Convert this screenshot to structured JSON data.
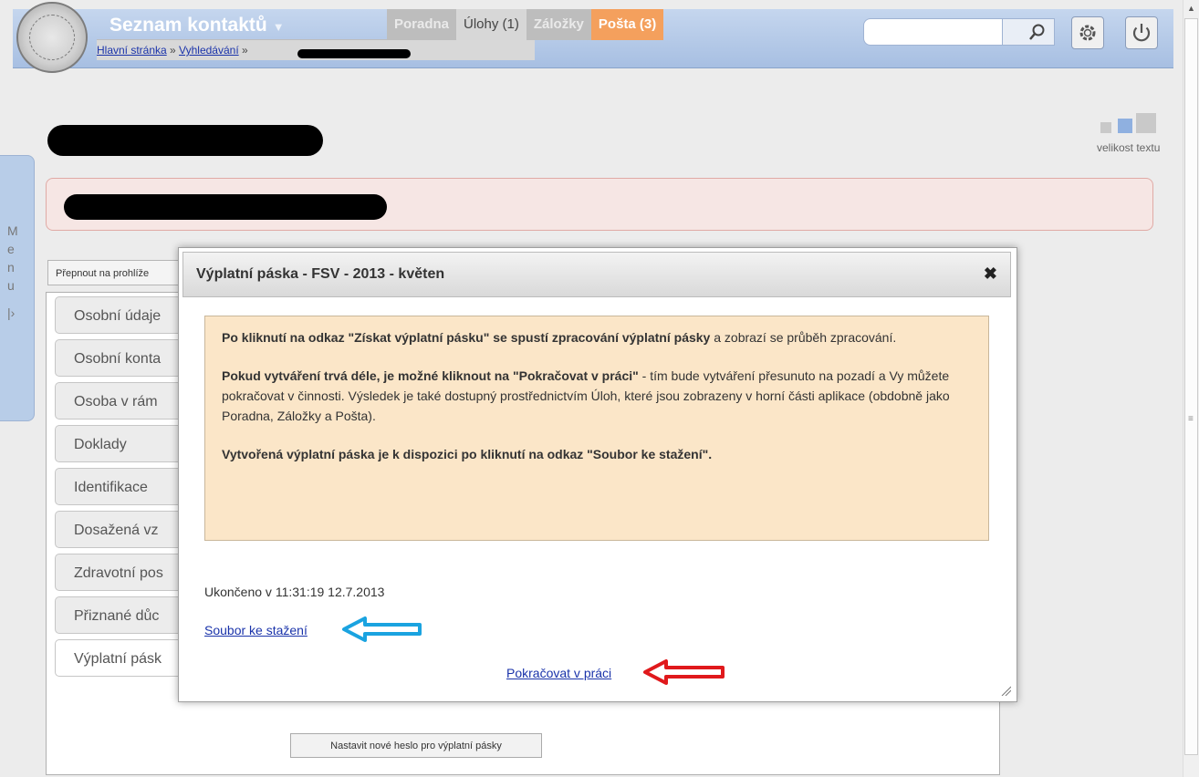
{
  "header": {
    "app_title": "Seznam kontaktů",
    "breadcrumb": {
      "home": "Hlavní stránka",
      "sep1": " » ",
      "search": "Vyhledávání",
      "sep2": " »"
    },
    "tabs": [
      {
        "label": "Poradna",
        "state": "dim"
      },
      {
        "label": "Úlohy (1)",
        "state": "active"
      },
      {
        "label": "Záložky",
        "state": "dim"
      },
      {
        "label": "Pošta (3)",
        "state": "highlight"
      }
    ],
    "search_placeholder": "",
    "icons": [
      "search-icon",
      "gear-icon",
      "power-icon"
    ]
  },
  "text_size": {
    "label": "velikost textu"
  },
  "menu_tab": {
    "letters": [
      "M",
      "e",
      "n",
      "u"
    ]
  },
  "switch_button": {
    "label": "Přepnout na prohlíže"
  },
  "side_nav": {
    "items": [
      "Osobní údaje",
      "Osobní konta",
      "Osoba v rám",
      "Doklady",
      "Identifikace",
      "Dosažená vz",
      "Zdravotní pos",
      "Přiznané důc",
      "Výplatní pásk"
    ],
    "active_index": 8
  },
  "set_password_button": {
    "label": "Nastavit nové heslo pro výplatní pásky"
  },
  "dialog": {
    "title": "Výplatní páska - FSV - 2013 - květen",
    "close_symbol": "✖",
    "info": {
      "p1_bold": "Po kliknutí na odkaz \"Získat výplatní pásku\" se spustí zpracování výplatní pásky",
      "p1_rest": " a zobrazí se průběh zpracování.",
      "p2_bold": "Pokud vytváření trvá déle, je možné kliknout na \"Pokračovat v práci\"",
      "p2_rest": " - tím bude vytváření přesunuto na pozadí a Vy můžete pokračovat v činnosti. Výsledek je také dostupný prostřednictvím Úloh, které jsou zobrazeny v horní části aplikace (obdobně jako Poradna, Záložky a Pošta).",
      "p3_bold": "Vytvořená výplatní páska je k dispozici po kliknutí na odkaz \"Soubor ke stažení\"."
    },
    "finished_text": "Ukončeno v 11:31:19 12.7.2013",
    "download_link": "Soubor ke stažení",
    "continue_link": "Pokračovat v práci"
  },
  "colors": {
    "header_blue": "#a7bfe2",
    "tab_orange": "#f4a05d",
    "info_bg": "#fbe6c8",
    "alert_bg": "#f6e6e4",
    "link": "#1a33aa",
    "arrow_blue": "#1aa3e0",
    "arrow_red": "#e0191c"
  }
}
